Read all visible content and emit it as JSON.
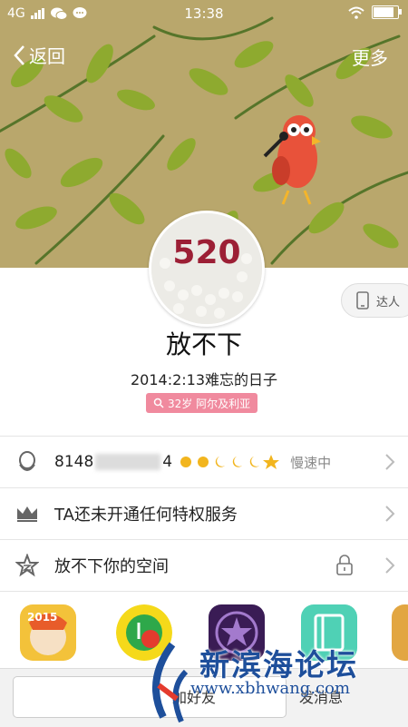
{
  "status_bar": {
    "network": "4G",
    "time": "13:38"
  },
  "nav": {
    "back_label": "返回",
    "more_label": "更多"
  },
  "profile": {
    "avatar_text": "520",
    "talent_label": "达人",
    "name": "放不下",
    "signature": "2014:2:13难忘的日子",
    "tag": "32岁 阿尔及利亚"
  },
  "rows": {
    "qq_prefix": "8148",
    "qq_suffix": "4",
    "speed": "慢速中",
    "privilege": "TA还未开通任何特权服务",
    "space": "放不下你的空间"
  },
  "bottom": {
    "left_label": "加好友",
    "right_label": "发消息"
  },
  "watermark": {
    "text": "新滨海论坛",
    "url": "www.xbhwang.com"
  },
  "colors": {
    "accent_tag": "#f08a9e",
    "banner": "#b7a56b"
  }
}
